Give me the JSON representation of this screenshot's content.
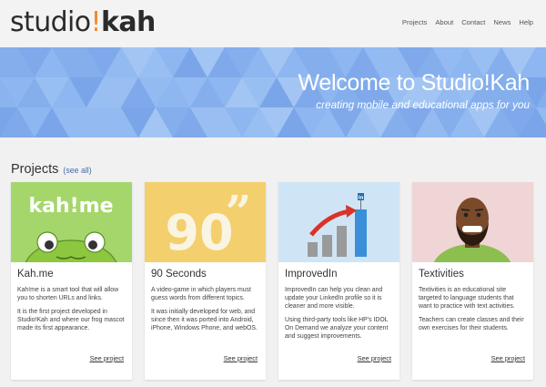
{
  "logo": {
    "part1": "studio",
    "bang": "!",
    "part2": "kah"
  },
  "nav": [
    "Projects",
    "About",
    "Contact",
    "News",
    "Help"
  ],
  "hero": {
    "title": "Welcome to Studio!Kah",
    "subtitle": "creating mobile and educational apps for you"
  },
  "projects": {
    "heading": "Projects",
    "see_all": "(see all)",
    "cards": [
      {
        "title": "Kah.me",
        "thumb_text": "kah!me",
        "paragraphs": [
          "Kah!me is a smart tool that will allow you to shorten URLs and links.",
          "It is the first project developed in Studio!Kah and where our frog mascot made its first appearance."
        ],
        "link": "See project"
      },
      {
        "title": "90 Seconds",
        "thumb_text": "90",
        "thumb_quote": "”",
        "paragraphs": [
          "A video-game in which players must guess words from different topics.",
          "It was initially developed for web, and since then it was ported into Android, iPhone, Windows Phone, and webOS."
        ],
        "link": "See project"
      },
      {
        "title": "ImprovedIn",
        "thumb_text": "in",
        "paragraphs": [
          "ImprovedIn can help you clean and update your LinkedIn profile so it is cleaner and more visible.",
          "Using third-party tools like HP's IDOL On Demand we analyze your content and suggest improvements."
        ],
        "link": "See project"
      },
      {
        "title": "Textivities",
        "paragraphs": [
          "Textivities is an educational site targeted to language students that want to practice with text activities.",
          "Teachers can create classes and their own exercises for their students."
        ],
        "link": "See project"
      }
    ]
  },
  "colors": {
    "hero_bg": "#8bb3ee",
    "accent_orange": "#f2892e",
    "frog_green": "#8dc63f",
    "thumb_yellow": "#f4cf6d",
    "thumb_blue": "#cfe5f5",
    "thumb_pink": "#f0d5d6"
  }
}
